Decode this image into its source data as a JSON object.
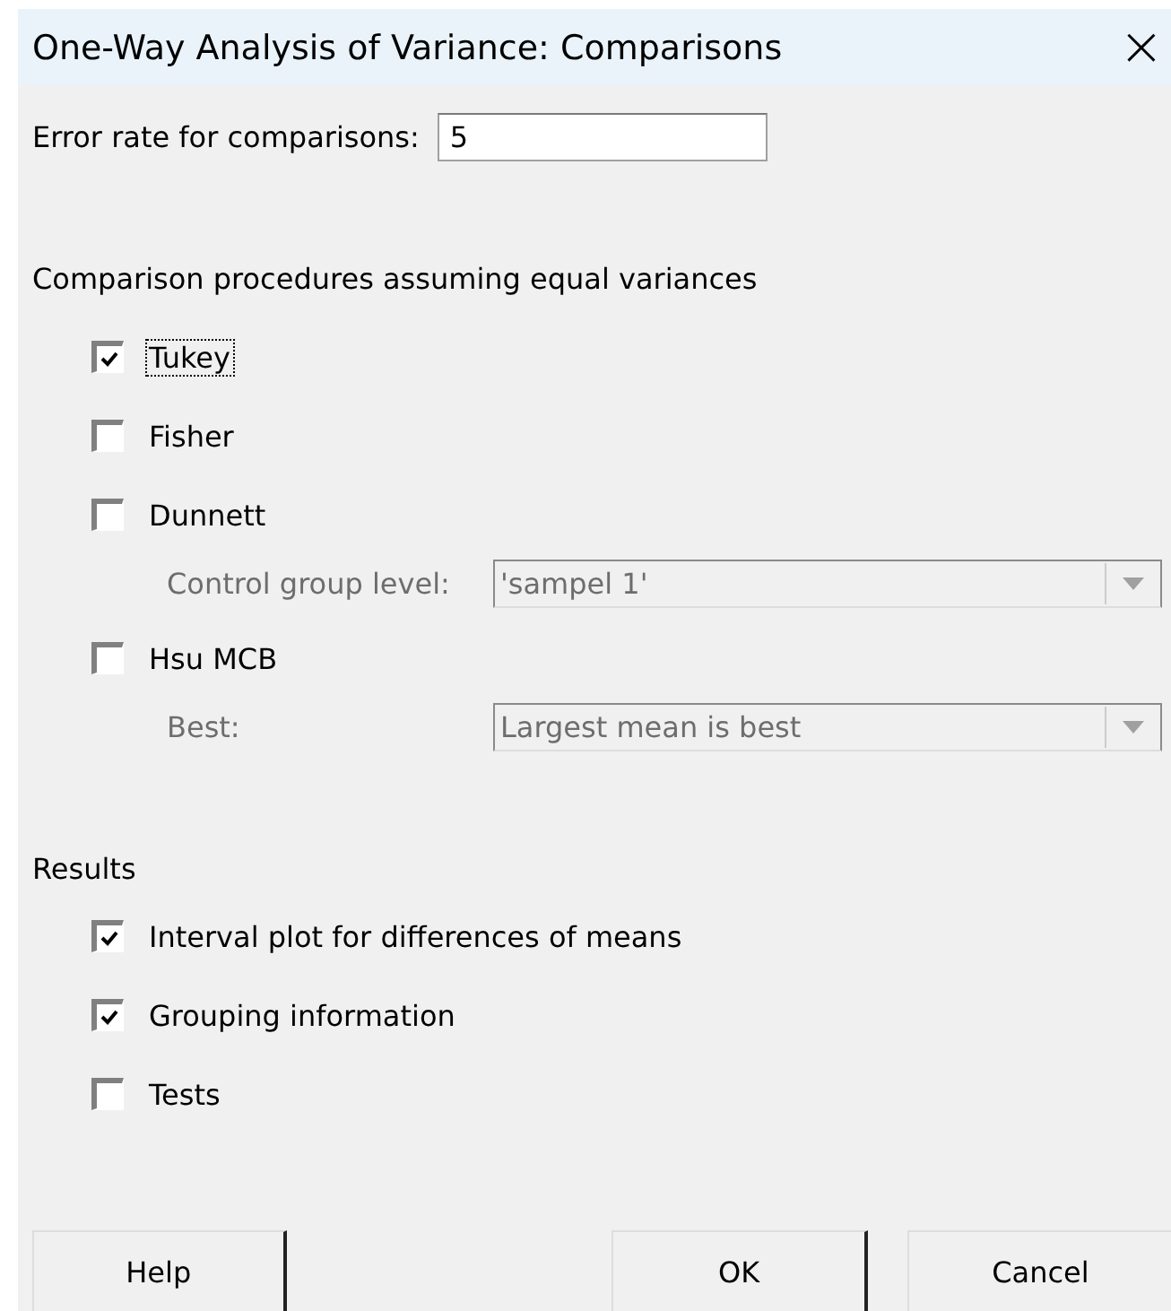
{
  "window": {
    "title": "One-Way Analysis of Variance: Comparisons",
    "close": "×"
  },
  "error_rate": {
    "label": "Error rate for comparisons:",
    "value": "5"
  },
  "equal_variances": {
    "heading": "Comparison procedures assuming equal variances",
    "items": [
      {
        "kind": "checkbox",
        "label": "Tukey",
        "checked": true,
        "focused": true
      },
      {
        "kind": "checkbox",
        "label": "Fisher",
        "checked": false,
        "focused": false
      },
      {
        "kind": "checkbox",
        "label": "Dunnett",
        "checked": false,
        "focused": false
      },
      {
        "kind": "dropdown",
        "label": "Control group level:",
        "value": "'sampel 1'",
        "disabled": true
      },
      {
        "kind": "checkbox",
        "label": "Hsu MCB",
        "checked": false,
        "focused": false
      },
      {
        "kind": "dropdown",
        "label": "Best:",
        "value": "Largest mean is best",
        "disabled": true
      }
    ]
  },
  "results": {
    "heading": "Results",
    "items": [
      {
        "kind": "checkbox",
        "label": "Interval plot for differences of means",
        "checked": true,
        "focused": false
      },
      {
        "kind": "checkbox",
        "label": "Grouping information",
        "checked": true,
        "focused": false
      },
      {
        "kind": "checkbox",
        "label": "Tests",
        "checked": false,
        "focused": false
      }
    ]
  },
  "buttons": [
    "Help",
    "OK",
    "Cancel"
  ]
}
